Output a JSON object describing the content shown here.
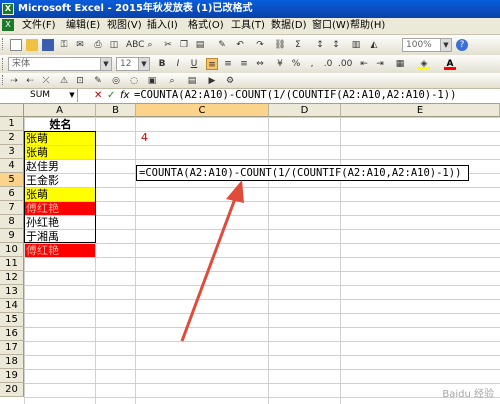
{
  "window": {
    "title": "Microsoft Excel - 2015年秋发放表 (1)已改格式"
  },
  "menu": [
    {
      "label": "文件(F)"
    },
    {
      "label": "编辑(E)"
    },
    {
      "label": "视图(V)"
    },
    {
      "label": "插入(I)"
    },
    {
      "label": "格式(O)"
    },
    {
      "label": "工具(T)"
    },
    {
      "label": "数据(D)"
    },
    {
      "label": "窗口(W)"
    },
    {
      "label": "帮助(H)"
    }
  ],
  "toolbar": {
    "zoom": "100%",
    "font_name": "宋体",
    "font_size": "12"
  },
  "formula_bar": {
    "name_box": "SUM",
    "cancel": "✕",
    "enter": "✓",
    "fx": "fx",
    "formula": "=COUNTA(A2:A10)-COUNT(1/(COUNTIF(A2:A10,A2:A10)-1))"
  },
  "columns": [
    "A",
    "B",
    "C",
    "D",
    "E"
  ],
  "rows": [
    "1",
    "2",
    "3",
    "4",
    "5",
    "6",
    "7",
    "8",
    "9",
    "10",
    "11",
    "12",
    "13",
    "14",
    "15",
    "16",
    "17",
    "18",
    "19",
    "20"
  ],
  "cells": {
    "A1": "姓名",
    "A2": "张萌",
    "A3": "张萌",
    "A4": "赵佳男",
    "A5": "王金影",
    "A6": "张萌",
    "A7": "傅红艳",
    "A8": "孙红艳",
    "A9": "于湘禹",
    "A10": "傅红艳",
    "C2": "4",
    "C5": "=COUNTA(A2:A10)-COUNT(1/(COUNTIF(A2:A10,A2:A10)-1))"
  },
  "colors": {
    "highlight_yellow": "#ffff00",
    "highlight_red": "#ff0000",
    "arrow": "#e04b3a",
    "result_text": "#cc0000"
  },
  "watermark": "Baidu 经验"
}
